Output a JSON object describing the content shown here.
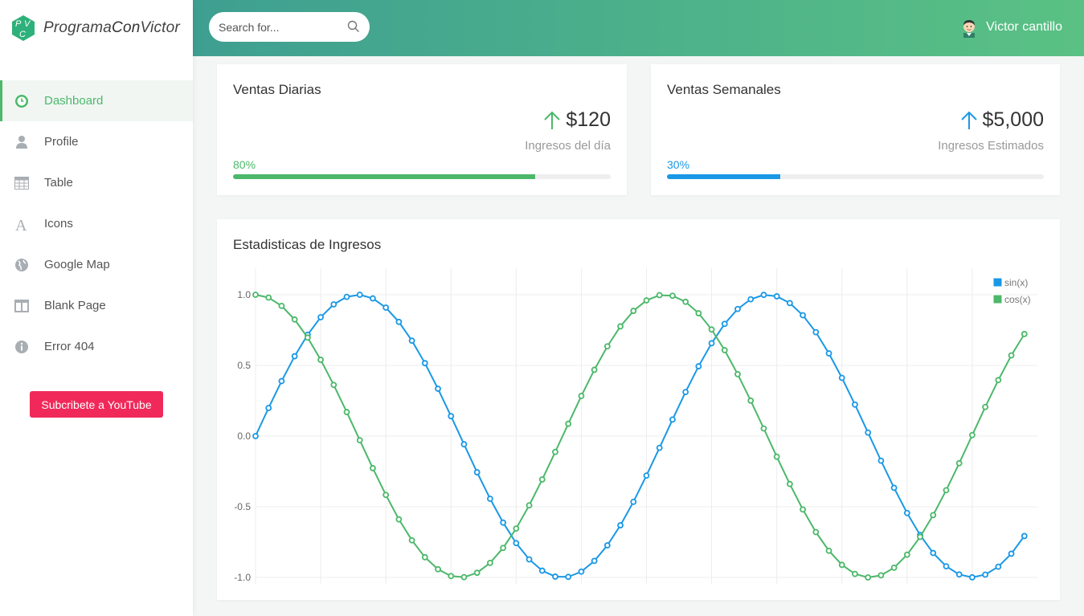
{
  "brand": {
    "name_a": "Programa",
    "name_b": "Con",
    "name_c": "Victor"
  },
  "search": {
    "placeholder": "Search for..."
  },
  "user": {
    "name": "Victor cantillo"
  },
  "sidebar": {
    "items": [
      {
        "label": "Dashboard",
        "icon": "clock-icon",
        "active": true
      },
      {
        "label": "Profile",
        "icon": "user-icon"
      },
      {
        "label": "Table",
        "icon": "table-icon"
      },
      {
        "label": "Icons",
        "icon": "font-icon"
      },
      {
        "label": "Google Map",
        "icon": "globe-icon"
      },
      {
        "label": "Blank Page",
        "icon": "columns-icon"
      },
      {
        "label": "Error 404",
        "icon": "info-icon"
      }
    ],
    "cta_label": "Subcribete a YouTube"
  },
  "cards": {
    "daily": {
      "title": "Ventas Diarias",
      "value": "$120",
      "subtitle": "Ingresos del día",
      "percent_label": "80%",
      "progress": 0.8,
      "color": "#4cb86a"
    },
    "weekly": {
      "title": "Ventas Semanales",
      "value": "$5,000",
      "subtitle": "Ingresos Estimados",
      "percent_label": "30%",
      "progress": 0.3,
      "color": "#1a98e6"
    }
  },
  "chart_title": "Estadisticas de Ingresos",
  "chart_data": {
    "type": "line",
    "title": "Estadisticas de Ingresos",
    "xlabel": "",
    "ylabel": "",
    "xlim": [
      0,
      12
    ],
    "ylim": [
      -1.0,
      1.0
    ],
    "xticks": [
      0,
      1,
      2,
      3,
      4,
      5,
      6,
      7,
      8,
      9,
      10,
      11
    ],
    "yticks": [
      1.0,
      0.5,
      0.0,
      -0.5,
      -1.0
    ],
    "grid": true,
    "legend": "top-right",
    "x_step": 0.2,
    "x_count": 60,
    "series": [
      {
        "name": "sin(x)",
        "function": "sin",
        "color": "#1a98e6",
        "values": [
          0.0,
          0.199,
          0.389,
          0.565,
          0.717,
          0.841,
          0.932,
          0.985,
          1.0,
          0.974,
          0.909,
          0.808,
          0.675,
          0.516,
          0.335,
          0.141,
          -0.058,
          -0.256,
          -0.443,
          -0.612,
          -0.757,
          -0.872,
          -0.952,
          -0.994,
          -0.996,
          -0.959,
          -0.883,
          -0.773,
          -0.631,
          -0.465,
          -0.279,
          -0.083,
          0.117,
          0.312,
          0.494,
          0.657,
          0.794,
          0.899,
          0.968,
          0.999,
          0.989,
          0.941,
          0.855,
          0.735,
          0.585,
          0.412,
          0.223,
          0.025,
          -0.174,
          -0.366,
          -0.544,
          -0.7,
          -0.827,
          -0.921,
          -0.979,
          -0.999,
          -0.98,
          -0.924,
          -0.832,
          -0.707
        ]
      },
      {
        "name": "cos(x)",
        "function": "cos",
        "color": "#4cb86a",
        "values": [
          1.0,
          0.98,
          0.921,
          0.825,
          0.697,
          0.54,
          0.362,
          0.17,
          -0.029,
          -0.227,
          -0.416,
          -0.589,
          -0.737,
          -0.857,
          -0.942,
          -0.99,
          -0.998,
          -0.967,
          -0.897,
          -0.791,
          -0.654,
          -0.49,
          -0.307,
          -0.112,
          0.087,
          0.284,
          0.469,
          0.635,
          0.776,
          0.886,
          0.96,
          0.997,
          0.993,
          0.95,
          0.869,
          0.754,
          0.608,
          0.438,
          0.251,
          0.054,
          -0.146,
          -0.339,
          -0.519,
          -0.679,
          -0.811,
          -0.911,
          -0.975,
          -1.0,
          -0.985,
          -0.931,
          -0.839,
          -0.713,
          -0.559,
          -0.383,
          -0.192,
          0.007,
          0.206,
          0.396,
          0.571,
          0.722
        ]
      }
    ]
  }
}
